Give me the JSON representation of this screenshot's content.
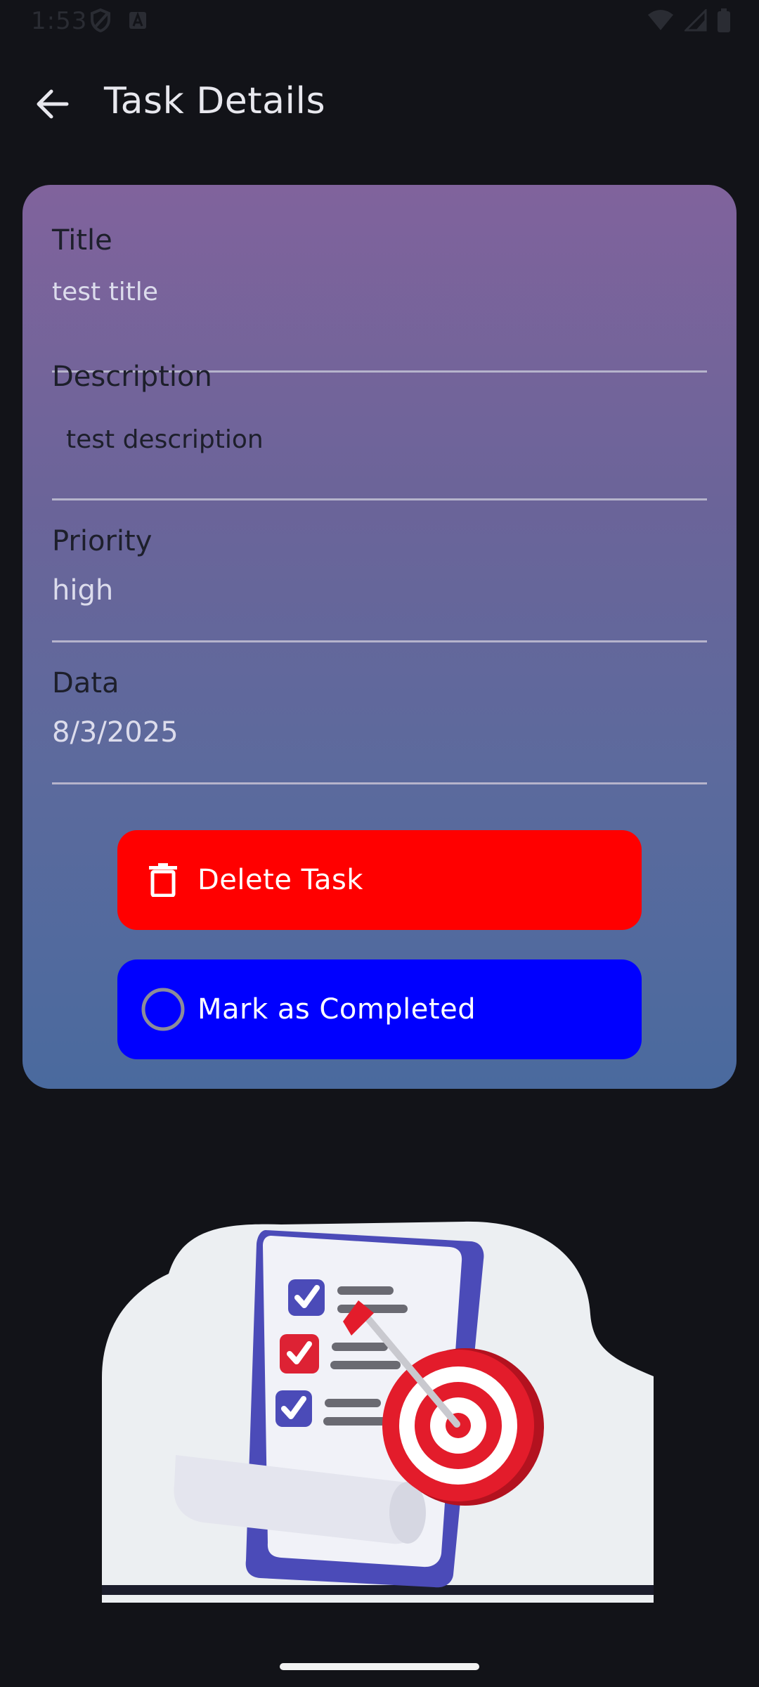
{
  "status_bar": {
    "time": "1:53",
    "left_icons": [
      "shield-icon",
      "a-notification-icon"
    ],
    "right_icons": [
      "wifi-icon",
      "signal-icon",
      "battery-icon"
    ]
  },
  "app_bar": {
    "back_icon": "arrow-left-icon",
    "title": "Task Details"
  },
  "task": {
    "title_label": "Title",
    "title_value": "test title",
    "description_label": "Description",
    "description_value": "test description",
    "priority_label": "Priority",
    "priority_value": "high",
    "date_label": "Data",
    "date_value": "8/3/2025"
  },
  "actions": {
    "delete_label": "Delete Task",
    "delete_icon": "trash-icon",
    "complete_label": "Mark as Completed",
    "complete_icon": "circle-outline-icon"
  },
  "colors": {
    "background": "#121318",
    "card_top": "#80639c",
    "card_bottom": "#4a6a9e",
    "delete_button": "#ff0000",
    "complete_button": "#0000ff"
  },
  "illustration": {
    "name": "task-checklist-target-illustration"
  }
}
